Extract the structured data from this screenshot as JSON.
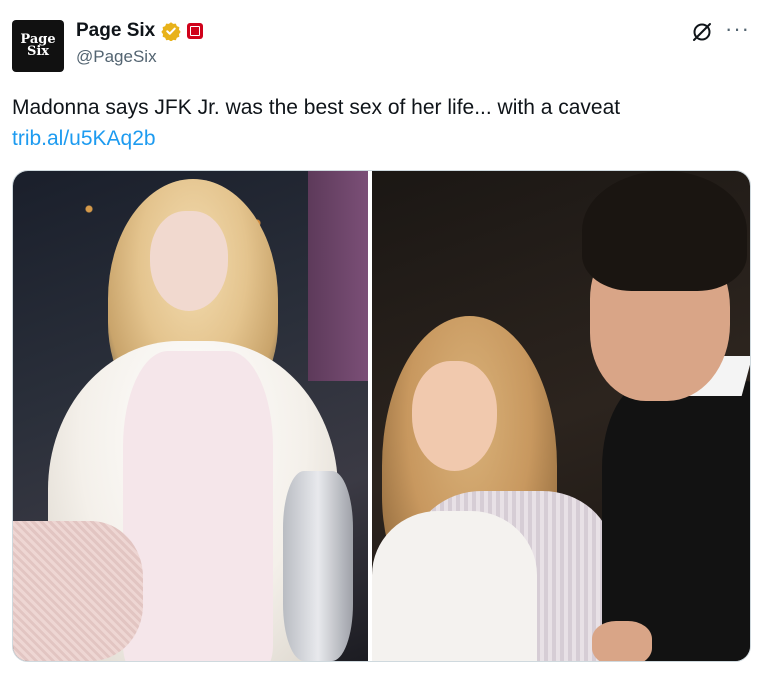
{
  "account": {
    "avatar_line1": "Page",
    "avatar_line2": "Six",
    "display_name": "Page Six",
    "handle": "@PageSix"
  },
  "icons": {
    "verified": "verified-badge-icon",
    "affiliate": "affiliate-badge-icon",
    "grok": "grok-icon",
    "more": "more-icon"
  },
  "colors": {
    "verified_gold": "#e8b21a",
    "affiliate_red": "#d0021b",
    "link_blue": "#1d9bf0",
    "secondary_text": "#536471"
  },
  "tweet": {
    "text": "Madonna says JFK Jr. was the best sex of her life... with a caveat",
    "link": "trib.al/u5KAq2b"
  },
  "more_glyph": "···"
}
